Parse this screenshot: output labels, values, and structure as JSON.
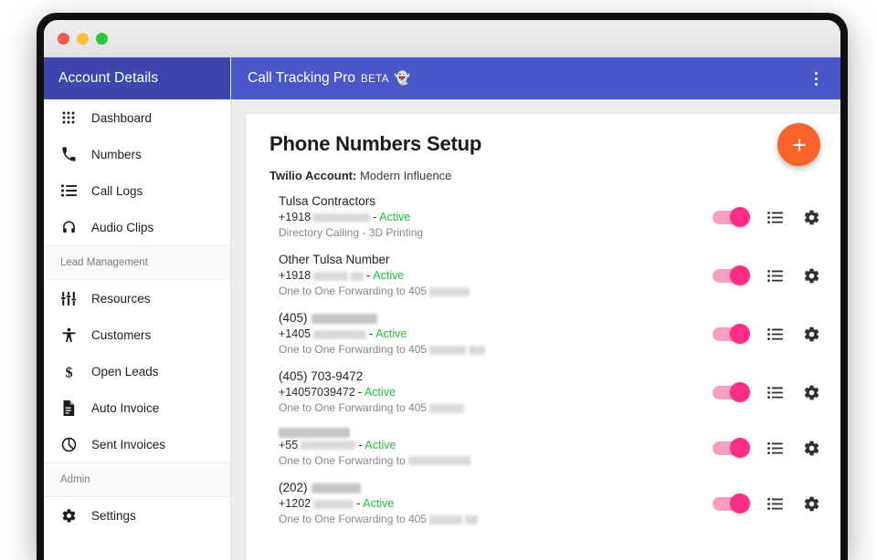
{
  "window": {
    "traffic_lights": [
      {
        "name": "close-button",
        "color": "#f05a4f"
      },
      {
        "name": "minimize-button",
        "color": "#f9bd3f"
      },
      {
        "name": "maximize-button",
        "color": "#29c83f"
      }
    ]
  },
  "sidebar": {
    "header_title": "Account Details",
    "header_bg": "#3c46ad",
    "items": [
      {
        "type": "item",
        "label": "Dashboard",
        "icon": "grid-icon"
      },
      {
        "type": "item",
        "label": "Numbers",
        "icon": "phone-icon"
      },
      {
        "type": "item",
        "label": "Call Logs",
        "icon": "list-icon"
      },
      {
        "type": "item",
        "label": "Audio Clips",
        "icon": "headphones-icon"
      },
      {
        "type": "section",
        "label": "Lead Management"
      },
      {
        "type": "item",
        "label": "Resources",
        "icon": "sliders-icon"
      },
      {
        "type": "item",
        "label": "Customers",
        "icon": "person-icon"
      },
      {
        "type": "item",
        "label": "Open Leads",
        "icon": "dollar-icon"
      },
      {
        "type": "item",
        "label": "Auto Invoice",
        "icon": "document-icon"
      },
      {
        "type": "item",
        "label": "Sent Invoices",
        "icon": "send-target-icon"
      },
      {
        "type": "section",
        "label": "Admin"
      },
      {
        "type": "item",
        "label": "Settings",
        "icon": "gear-icon"
      }
    ]
  },
  "topbar": {
    "app_name": "Call Tracking Pro",
    "beta_label": "BETA",
    "emoji": "👻",
    "bg": "#4b56c8",
    "overflow_menu": "kebab-menu"
  },
  "main": {
    "page_title": "Phone Numbers Setup",
    "account_label": "Twilio Account:",
    "account_value": "Modern Influence",
    "fab": {
      "label": "+",
      "color": "#f9642a",
      "name": "add-number-button"
    },
    "row_actions": {
      "toggle_name": "number-enabled-toggle",
      "toggle_on_color": "#ff2d87",
      "toggle_track_color": "#f8a0c4",
      "list_icon": "list-icon",
      "gear_icon": "gear-icon"
    },
    "status_active": "Active",
    "status_active_color": "#22c03c",
    "separator": "-",
    "numbers": [
      {
        "name": "Tulsa Contractors",
        "name_redacted_width": 0,
        "e164_prefix": "+1918",
        "e164_redacted_width": 62,
        "e164_redacted_width2": 0,
        "status": "Active",
        "sub_text": "Directory Calling - 3D Printing",
        "sub_redacted_width": 0,
        "sub_redacted_width2": 0,
        "enabled": true
      },
      {
        "name": "Other Tulsa Number",
        "name_redacted_width": 0,
        "e164_prefix": "+1918",
        "e164_redacted_width": 38,
        "e164_redacted_width2": 14,
        "status": "Active",
        "sub_text": "One to One Forwarding to 405",
        "sub_redacted_width": 44,
        "sub_redacted_width2": 0,
        "enabled": true
      },
      {
        "name": "(405)",
        "name_redacted_width": 72,
        "e164_prefix": "+1405",
        "e164_redacted_width": 58,
        "e164_redacted_width2": 0,
        "status": "Active",
        "sub_text": "One to One Forwarding to 405",
        "sub_redacted_width": 40,
        "sub_redacted_width2": 18,
        "enabled": true
      },
      {
        "name": "(405) 703-9472",
        "name_redacted_width": 0,
        "e164_prefix": "+14057039472",
        "e164_redacted_width": 0,
        "e164_redacted_width2": 0,
        "status": "Active",
        "sub_text": "One to One Forwarding to 405",
        "sub_redacted_width": 38,
        "sub_redacted_width2": 0,
        "enabled": true
      },
      {
        "name": "",
        "name_redacted_width": 78,
        "e164_prefix": "+55",
        "e164_redacted_width": 60,
        "e164_redacted_width2": 0,
        "status": "Active",
        "sub_text": "One to One Forwarding to",
        "sub_redacted_width": 68,
        "sub_redacted_width2": 0,
        "enabled": true
      },
      {
        "name": "(202)",
        "name_redacted_width": 54,
        "e164_prefix": "+1202",
        "e164_redacted_width": 44,
        "e164_redacted_width2": 0,
        "status": "Active",
        "sub_text": "One to One Forwarding to 405",
        "sub_redacted_width": 36,
        "sub_redacted_width2": 14,
        "enabled": true
      }
    ]
  }
}
